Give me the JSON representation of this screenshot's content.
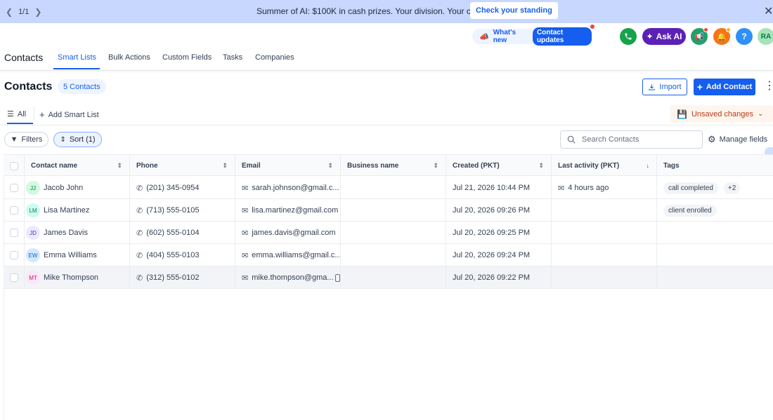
{
  "banner": {
    "pager": "1/1",
    "message": "Summer of AI: $100K in cash prizes. Your division. Your clients.",
    "cta": "Check your standing"
  },
  "header": {
    "whats_new": "What's new",
    "contact_updates": "Contact updates",
    "ask_ai": "Ask AI",
    "help": "?",
    "user_initials": "RA"
  },
  "nav": {
    "app_title": "Contacts",
    "tabs": [
      "Smart Lists",
      "Bulk Actions",
      "Custom Fields",
      "Tasks",
      "Companies"
    ]
  },
  "page": {
    "title": "Contacts",
    "count": "5 Contacts",
    "import_label": "Import",
    "add_label": "Add Contact"
  },
  "smart_lists": {
    "all": "All",
    "add": "Add Smart List",
    "unsaved": "Unsaved changes"
  },
  "toolbar": {
    "filters": "Filters",
    "sort": "Sort (1)",
    "search_placeholder": "Search Contacts",
    "manage_fields": "Manage fields"
  },
  "table": {
    "columns": [
      "Contact name",
      "Phone",
      "Email",
      "Business name",
      "Created (PKT)",
      "Last activity (PKT)",
      "Tags"
    ],
    "rows": [
      {
        "initials": "JJ",
        "name": "Jacob John",
        "phone": "(201) 345-0954",
        "email": "sarah.johnson@gmail.c...",
        "business": "",
        "created": "Jul 21, 2026 10:44 PM",
        "activity": "4 hours ago",
        "tags": [
          "call completed"
        ],
        "more": "+2"
      },
      {
        "initials": "LM",
        "name": "Lisa Martinez",
        "phone": "(713) 555-0105",
        "email": "lisa.martinez@gmail.com",
        "business": "",
        "created": "Jul 20, 2026 09:26 PM",
        "activity": "",
        "tags": [
          "client enrolled"
        ],
        "more": ""
      },
      {
        "initials": "JD",
        "name": "James Davis",
        "phone": "(602) 555-0104",
        "email": "james.davis@gmail.com",
        "business": "",
        "created": "Jul 20, 2026 09:25 PM",
        "activity": "",
        "tags": [],
        "more": ""
      },
      {
        "initials": "EW",
        "name": "Emma Williams",
        "phone": "(404) 555-0103",
        "email": "emma.williams@gmail.c...",
        "business": "",
        "created": "Jul 20, 2026 09:24 PM",
        "activity": "",
        "tags": [],
        "more": ""
      },
      {
        "initials": "MT",
        "name": "Mike Thompson",
        "phone": "(312) 555-0102",
        "email": "mike.thompson@gma...",
        "business": "",
        "created": "Jul 20, 2026 09:22 PM",
        "activity": "",
        "tags": [],
        "more": ""
      }
    ]
  },
  "colors": {
    "accent": "#155eef",
    "banner_bg": "#c7d7fe",
    "ai_purple": "#5b21b6",
    "phone_green": "#16a34a",
    "bell_orange": "#f97316"
  }
}
